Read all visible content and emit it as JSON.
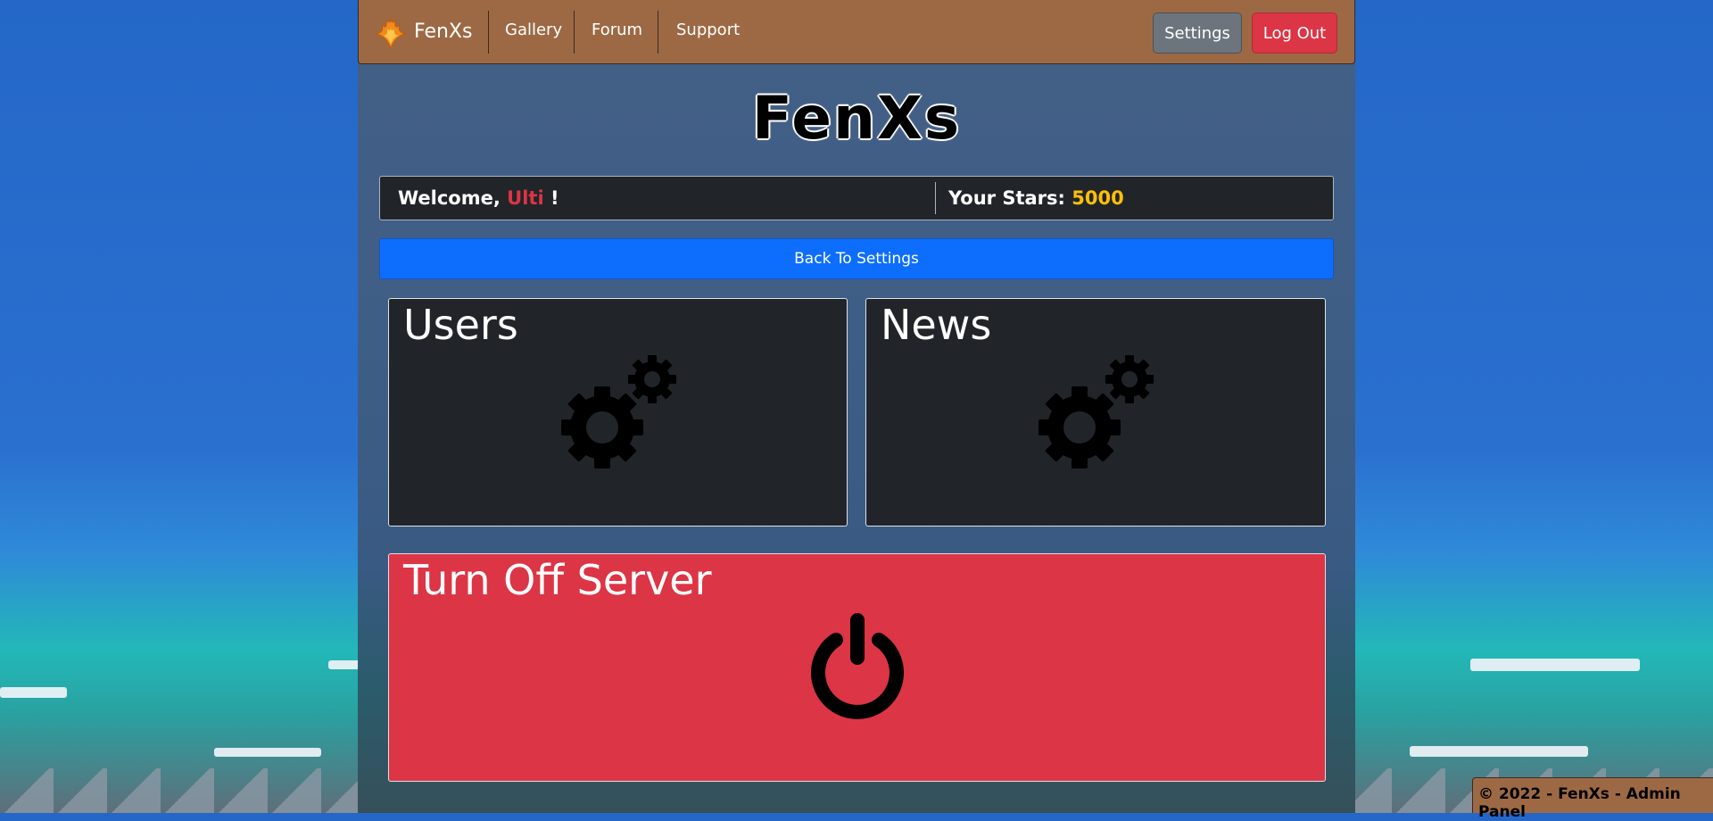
{
  "navbar": {
    "brand_name": "FenXs",
    "links": [
      "Gallery",
      "Forum",
      "Support"
    ],
    "settings_label": "Settings",
    "logout_label": "Log Out"
  },
  "header": {
    "site_title": "FenXs"
  },
  "info_bar": {
    "welcome_prefix": "Welcome, ",
    "username": "Ulti",
    "welcome_suffix": " !",
    "stars_label": "Your Stars: ",
    "stars_value": "5000"
  },
  "back_button_label": "Back To Settings",
  "cards": {
    "users_title": "Users",
    "users_icon": "gears-icon",
    "news_title": "News",
    "news_icon": "gears-icon",
    "server_title": "Turn Off Server",
    "server_icon": "power-icon"
  },
  "footer": {
    "text": "© 2022 - FenXs - Admin Panel"
  },
  "colors": {
    "navbar": "#9d6945",
    "danger": "#dc3545",
    "primary": "#0d6efd",
    "stars": "#ffc107",
    "card": "#212529"
  }
}
